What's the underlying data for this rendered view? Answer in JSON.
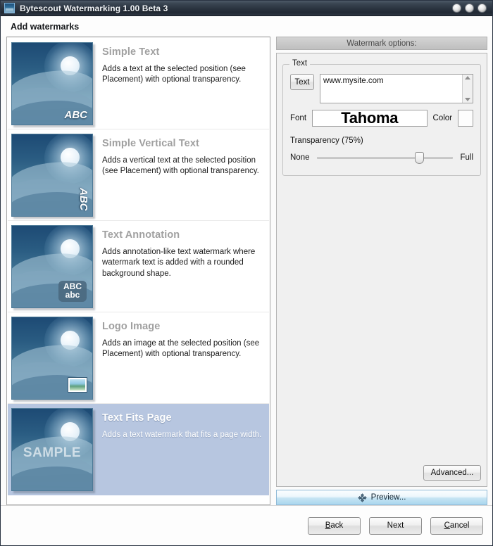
{
  "window": {
    "title": "Bytescout Watermarking 1.00 Beta 3",
    "app_icon": "app-image-icon",
    "controls": [
      {
        "name": "minimize-button",
        "icon": "circle-button-icon"
      },
      {
        "name": "maximize-button",
        "icon": "circle-button-icon"
      },
      {
        "name": "close-button",
        "icon": "circle-button-icon"
      }
    ]
  },
  "header": {
    "title": "Add watermarks"
  },
  "watermark_list": [
    {
      "title": "Simple Text",
      "description": "Adds a text at the selected position (see Placement) with optional transparency.",
      "thumb_kind": "abc",
      "thumb_label": "ABC",
      "selected": false
    },
    {
      "title": "Simple Vertical Text",
      "description": "Adds a vertical text at the selected position (see Placement) with optional transparency.",
      "thumb_kind": "vertical-abc",
      "thumb_label": "ABC",
      "selected": false
    },
    {
      "title": "Text Annotation",
      "description": "Adds annotation-like text watermark where watermark text is added with a rounded background shape.",
      "thumb_kind": "annotation",
      "thumb_label": "ABC",
      "thumb_label2": "abc",
      "selected": false
    },
    {
      "title": "Logo Image",
      "description": "Adds an image at the selected position (see Placement) with optional transparency.",
      "thumb_kind": "logo",
      "thumb_label": "",
      "selected": false
    },
    {
      "title": "Text Fits Page",
      "description": "Adds a text watermark that fits a page width.",
      "thumb_kind": "sample",
      "thumb_label": "SAMPLE",
      "selected": true
    }
  ],
  "options": {
    "header": "Watermark options:",
    "group_legend": "Text",
    "text_button": "Text",
    "text_value": "www.mysite.com",
    "text_placeholder": "",
    "scroll_up_icon": "triangle-up-icon",
    "scroll_down_icon": "triangle-down-icon",
    "font_label": "Font",
    "font_sample": "Tahoma",
    "color_label": "Color",
    "color_value": "#fdfdfd",
    "transparency_label": "Transparency (75%)",
    "transparency_percent": 75,
    "slider_min_label": "None",
    "slider_max_label": "Full",
    "advanced_button": "Advanced...",
    "preview_button": "Preview...",
    "preview_icon": "move-arrows-icon"
  },
  "footer": {
    "back": {
      "pre": "",
      "accel": "B",
      "post": "ack"
    },
    "next": {
      "pre": "",
      "accel": "",
      "post": "Next"
    },
    "cancel": {
      "pre": "",
      "accel": "C",
      "post": "ancel"
    }
  },
  "colors": {
    "titlebar_dark": "#2b3440",
    "selection_blue": "#b7c6e0",
    "thumb_blue": "#2a5c82",
    "preview_blue": "#a9d6ee",
    "options_header_gray": "#c9c9c9"
  }
}
